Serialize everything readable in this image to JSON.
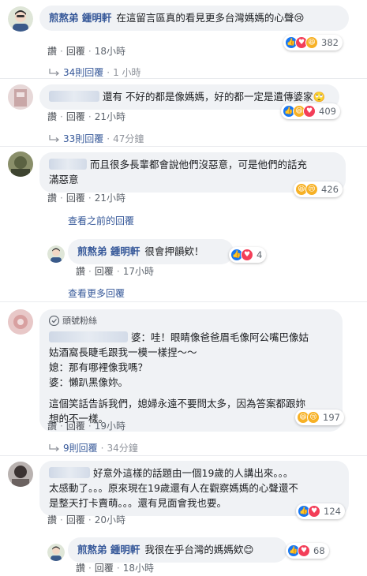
{
  "comments": [
    {
      "name": "煎熬弟 鍾明軒",
      "text": "在這留言區真的看見更多台灣媽媽的心聲😢",
      "actions": [
        "讚",
        "回覆",
        "18小時"
      ],
      "reactions_count": "382",
      "replies": "34則回覆",
      "replies_time": "1 小時"
    },
    {
      "name": "",
      "text": "還有 不好的都是像媽媽，好的都一定是遺傳婆家🙄",
      "actions": [
        "讚",
        "回覆",
        "21小時"
      ],
      "reactions_count": "409",
      "replies": "33則回覆",
      "replies_time": "47分鐘"
    },
    {
      "name": "",
      "text_line1": "而且很多長輩都會說他們沒惡意，可是他們的話充",
      "text_line2": "滿惡意",
      "actions": [
        "讚",
        "回覆",
        "21小時"
      ],
      "reactions_count": "426"
    },
    {
      "name": "",
      "badge": "頭號粉絲",
      "text_lines": [
        "婆：哇！眼睛像爸爸眉毛像阿公嘴巴像姑",
        "姑酒窩長睫毛跟我一模一樣捏～～",
        "媳：那有哪裡像我嗎？",
        "婆：懶趴黑像妳。",
        "這個笑話告訴我們，媳婦永遠不要問太多，因為答案都跟妳",
        "想的不一樣。"
      ],
      "actions": [
        "讚",
        "回覆",
        "19小時"
      ],
      "reactions_count": "197",
      "replies": "9則回覆",
      "replies_time": "34分鐘"
    },
    {
      "name": "",
      "text_lines": [
        "好意外這樣的話題由一個19歲的人講出來。。。",
        "太感動了。。。原來現在19歲還有人在觀察媽媽的心聲還不",
        "是整天打卡賣萌。。。還有見面會我也要。"
      ],
      "actions": [
        "讚",
        "回覆",
        "20小時"
      ],
      "reactions_count": "124"
    }
  ],
  "view_previous": "查看之前的回覆",
  "view_more": "查看更多回覆",
  "reply_1": {
    "name": "煎熬弟 鍾明軒",
    "text": "很會押韻欸！",
    "actions": [
      "讚",
      "回覆",
      "17小時"
    ],
    "reactions_count": "4"
  },
  "reply_2": {
    "name": "煎熬弟 鍾明軒",
    "text": "我很在乎台灣的媽媽欸😊",
    "actions": [
      "讚",
      "回覆",
      "18小時"
    ],
    "reactions_count": "68"
  },
  "colors": {
    "link": "#365899",
    "bubble": "#f0f2f5",
    "like": "#1877f2",
    "love": "#f33e58",
    "haha": "#f7b125"
  }
}
